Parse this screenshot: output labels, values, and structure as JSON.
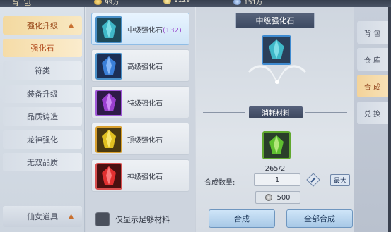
{
  "top_bar": {
    "title": "背包",
    "resources": [
      {
        "icon": "gold-coin-icon",
        "value": "99万"
      },
      {
        "icon": "ingot-icon",
        "value": "1129"
      },
      {
        "icon": "silver-coin-icon",
        "value": "151万"
      }
    ]
  },
  "left_menu": {
    "category": "强化升级",
    "items": [
      {
        "label": "强化石",
        "selected": true
      },
      {
        "label": "符类"
      },
      {
        "label": "装备升级"
      },
      {
        "label": "品质铸造"
      },
      {
        "label": "龙神强化"
      },
      {
        "label": "无双品质"
      }
    ],
    "bottom": "仙女道具"
  },
  "item_list": {
    "items": [
      {
        "name": "中级强化石",
        "count": "(132)",
        "color": "#3fb8c8",
        "border": "#4a90c8",
        "bg": "#1d4a5a",
        "active": true
      },
      {
        "name": "高级强化石",
        "count": "",
        "color": "#3a7fd8",
        "border": "#4a90c8",
        "bg": "#1c2f55"
      },
      {
        "name": "特级强化石",
        "count": "",
        "color": "#9a3fd0",
        "border": "#a05ad8",
        "bg": "#2e1a48"
      },
      {
        "name": "顶级强化石",
        "count": "",
        "color": "#e0c020",
        "border": "#d8a030",
        "bg": "#4a3a10"
      },
      {
        "name": "神级强化石",
        "count": "",
        "color": "#e03030",
        "border": "#d85050",
        "bg": "#4a1010"
      }
    ],
    "filter_label": "仅显示足够材料"
  },
  "detail": {
    "title": "中级强化石",
    "materials_label": "消耗材料",
    "material_count": "265/2",
    "qty_label": "合成数量:",
    "qty_value": "1",
    "max_label": "最大",
    "cost_value": "500",
    "craft_label": "合成",
    "craft_all_label": "全部合成",
    "target_gem_color": "#3fb8c8",
    "material_gem_color": "#5fc030"
  },
  "tabs": [
    {
      "label": "背包"
    },
    {
      "label": "仓库"
    },
    {
      "label": "合成",
      "active": true
    },
    {
      "label": "兑换"
    }
  ]
}
